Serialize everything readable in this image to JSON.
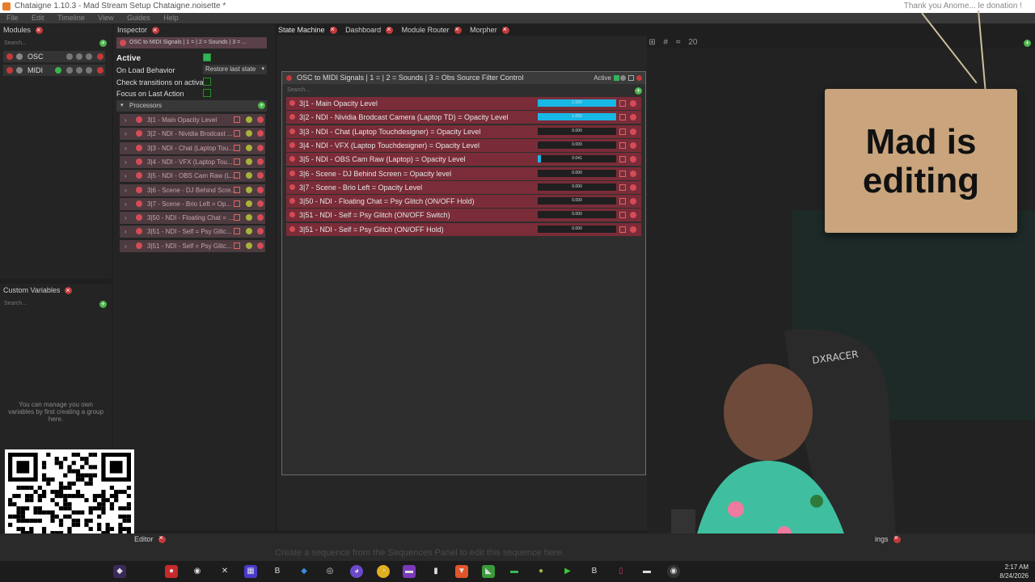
{
  "window": {
    "title": "Chataigne 1.10.3 - Mad Stream Setup Chataigne.noisette *",
    "top_right_text": "Thank you Anome... le donation !"
  },
  "menu": [
    "File",
    "Edit",
    "Timeline",
    "View",
    "Guides",
    "Help"
  ],
  "modules": {
    "title": "Modules",
    "search_placeholder": "Search...",
    "items": [
      {
        "label": "OSC"
      },
      {
        "label": "MIDI"
      }
    ]
  },
  "custom_variables": {
    "title": "Custom Variables",
    "search_placeholder": "Search...",
    "empty_message": "You can manage you own variables by first creating a group here."
  },
  "inspector": {
    "title": "Inspector",
    "header": "OSC to MIDI Signals | 1 = | 2 = Sounds | 3 = ...",
    "active_label": "Active",
    "on_load_label": "On Load Behavior",
    "on_load_value": "Restore last state",
    "check_transitions_label": "Check transitions on activate",
    "focus_label": "Focus on Last Action",
    "processors_label": "Processors",
    "processors": [
      "3|1 - Main Opacity Level",
      "3|2 - NDI - Nividia Brodcast ...",
      "3|3 - NDI - Chat (Laptop Tou...",
      "3|4 - NDI - VFX (Laptop Tou...",
      "3|5 - NDI - OBS Cam Raw (L...",
      "3|6 - Scene - DJ Behind Scre...",
      "3|7 - Scene - Brio Left = Op...",
      "3|50 - NDI - Floating Chat = ...",
      "3|51 - NDI - Self = Psy Glitc...",
      "3|51 - NDI - Self = Psy Glitc..."
    ]
  },
  "tabs": [
    {
      "label": "State Machine"
    },
    {
      "label": "Dashboard"
    },
    {
      "label": "Module Router"
    },
    {
      "label": "Morpher"
    }
  ],
  "toolbar": {
    "zoom": "20"
  },
  "node": {
    "title": "OSC to MIDI Signals | 1 = | 2 = Sounds | 3 = Obs Source Filter Control",
    "active_label": "Active",
    "search_placeholder": "Search...",
    "signals": [
      {
        "label": "3|1 - Main Opacity Level",
        "value": "1.000",
        "level": 1.0
      },
      {
        "label": "3|2 - NDI - Nividia Brodcast Camera (Laptop TD) = Opacity Level",
        "value": "1.000",
        "level": 1.0
      },
      {
        "label": "3|3 - NDI - Chat (Laptop Touchdesigner) = Opacity Level",
        "value": "0.000",
        "level": 0
      },
      {
        "label": "3|4 - NDI - VFX (Laptop Touchdesigner) = Opacity Level",
        "value": "0.000",
        "level": 0
      },
      {
        "label": "3|5 - NDI - OBS Cam Raw (Laptop) = Opacity Level",
        "value": "0.041",
        "level": 0.041
      },
      {
        "label": "3|6 - Scene - DJ Behind Screen = Opacity level",
        "value": "0.000",
        "level": 0
      },
      {
        "label": "3|7 - Scene - Brio Left = Opacity Level",
        "value": "0.000",
        "level": 0
      },
      {
        "label": "3|50 - NDI - Floating Chat = Psy Glitch (ON/OFF Hold)",
        "value": "0.000",
        "level": 0
      },
      {
        "label": "3|51 - NDI - Self = Psy Glitch (ON/OFF Switch)",
        "value": "0.000",
        "level": 0
      },
      {
        "label": "3|51 - NDI - Self = Psy Glitch (ON/OFF Hold)",
        "value": "0.000",
        "level": 0
      }
    ]
  },
  "overlay": {
    "sign_text": "Mad is editing",
    "chair_brand": "DXRACER"
  },
  "bottom": {
    "editor_label": "Editor",
    "settings_label": "ings",
    "sequence_message": "Create a sequence from the Sequences Panel to edit this sequence here."
  },
  "clock": {
    "time": "2:17 AM",
    "date": "8/24/2026"
  },
  "colors": {
    "accent": "#17b8e6",
    "signal_row": "#7a2c38",
    "close": "#c23a3a",
    "add": "#4bb54b"
  }
}
